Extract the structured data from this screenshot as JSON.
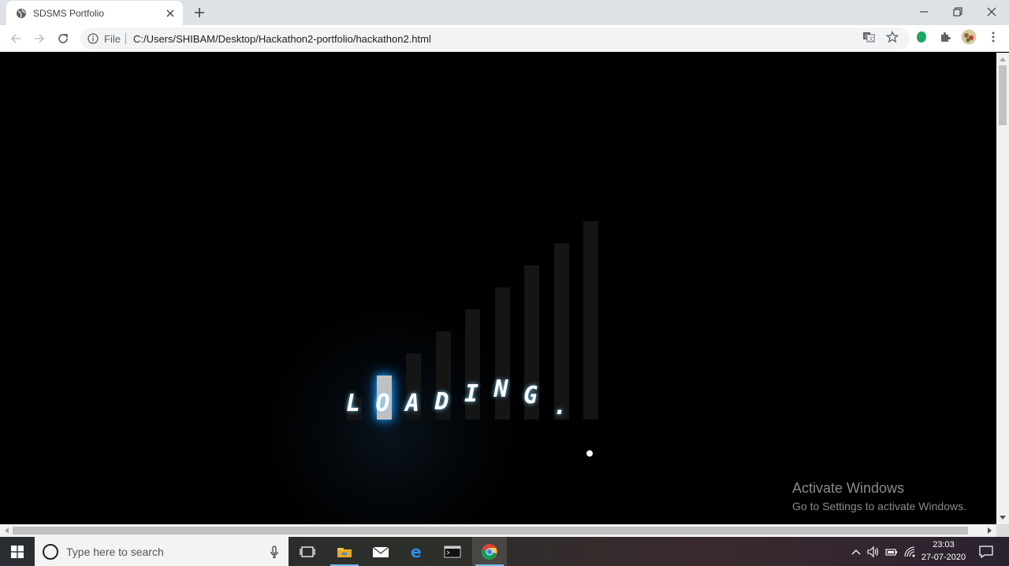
{
  "browser": {
    "tab_title": "SDSMS Portfolio",
    "omnibox_scheme": "File",
    "url": "C:/Users/SHIBAM/Desktop/Hackathon2-portfolio/hackathon2.html"
  },
  "page": {
    "loading_letters": [
      "L",
      "O",
      "A",
      "D",
      "I",
      "N",
      "G",
      "."
    ],
    "active_letter_index": 1,
    "bar_count": 9
  },
  "watermark": {
    "title": "Activate Windows",
    "subtitle": "Go to Settings to activate Windows."
  },
  "taskbar": {
    "search_placeholder": "Type here to search",
    "time": "23:03",
    "date": "27-07-2020"
  },
  "colors": {
    "glow": "#1ea0ff",
    "chrome_tabstrip": "#dee1e6",
    "taskbar_accent": "#76b9ed"
  }
}
